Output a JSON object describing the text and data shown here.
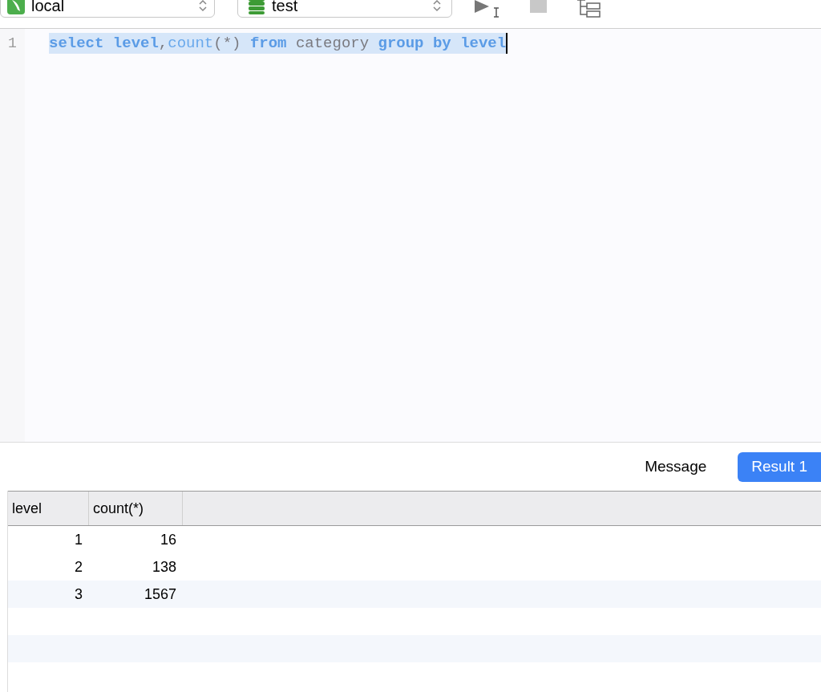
{
  "toolbar": {
    "connection": "local",
    "database": "test"
  },
  "editor": {
    "lines": [
      {
        "number": "1",
        "selected": true,
        "tokens": [
          {
            "kind": "keyword",
            "text": "select "
          },
          {
            "kind": "keyword",
            "text": "level"
          },
          {
            "kind": "plain",
            "text": ","
          },
          {
            "kind": "function",
            "text": "count"
          },
          {
            "kind": "plain",
            "text": "(*) "
          },
          {
            "kind": "keyword",
            "text": "from"
          },
          {
            "kind": "plain",
            "text": " category "
          },
          {
            "kind": "keyword",
            "text": "group by level"
          }
        ]
      }
    ]
  },
  "tabs": [
    {
      "label": "Message",
      "selected": false
    },
    {
      "label": "Result 1",
      "selected": true
    }
  ],
  "table": {
    "columns": [
      "level",
      "count(*)"
    ],
    "rows": [
      [
        "1",
        "16"
      ],
      [
        "2",
        "138"
      ],
      [
        "3",
        "1567"
      ]
    ]
  }
}
